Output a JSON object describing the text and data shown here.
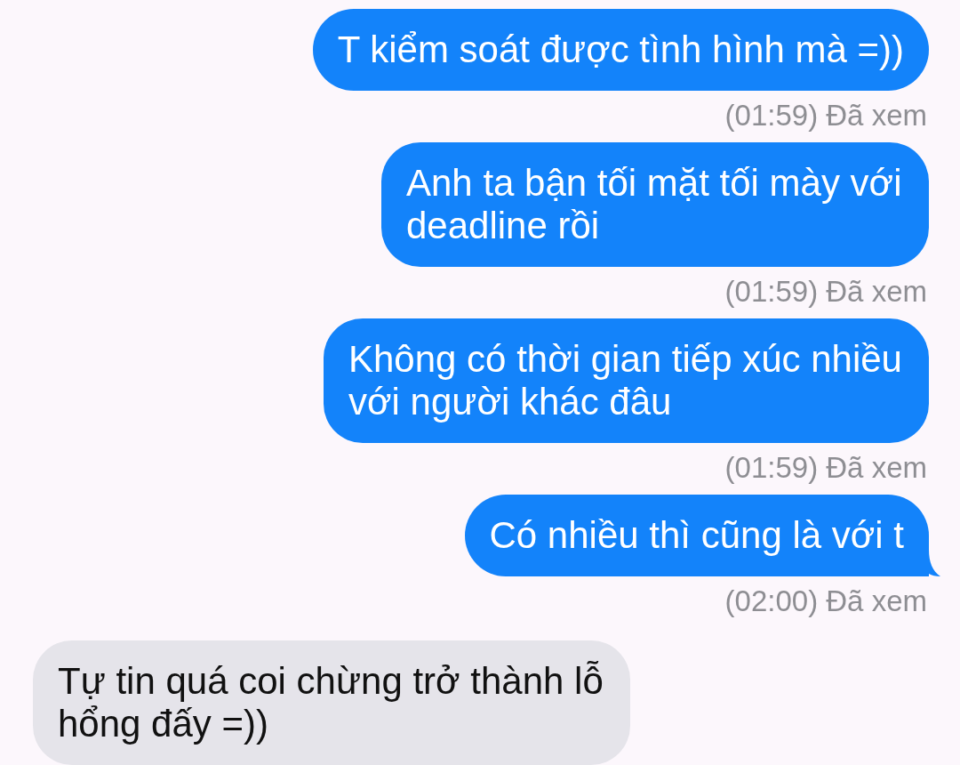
{
  "messages": [
    {
      "kind": "outgoing",
      "text": "T kiểm soát được tình hình mà =))",
      "receipt": "(01:59) Đã xem",
      "tail": false
    },
    {
      "kind": "outgoing",
      "text": "Anh ta bận tối mặt tối mày với deadline rồi",
      "receipt": "(01:59) Đã xem",
      "tail": false
    },
    {
      "kind": "outgoing",
      "text": "Không có thời gian tiếp xúc nhiều với người khác đâu",
      "receipt": "(01:59) Đã xem",
      "tail": false
    },
    {
      "kind": "outgoing",
      "text": "Có nhiều thì cũng là với t",
      "receipt": "(02:00) Đã xem",
      "tail": true
    },
    {
      "kind": "incoming",
      "text": "Tự tin quá coi chừng trở thành lỗ hổng đấy =))"
    }
  ]
}
